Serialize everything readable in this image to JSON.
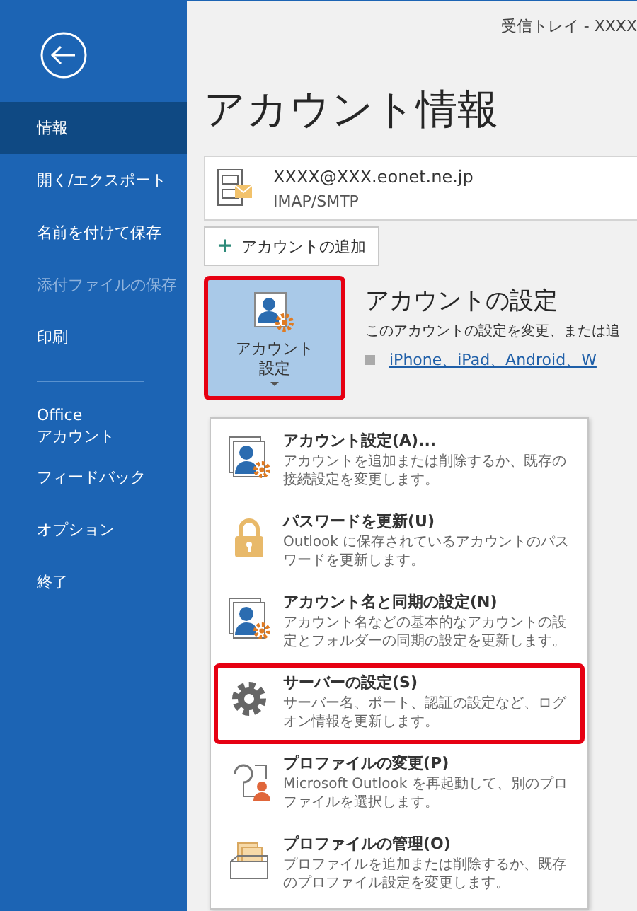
{
  "window": {
    "title": "受信トレイ - XXXX"
  },
  "sidebar": {
    "groups": [
      {
        "items": [
          {
            "label": "情報",
            "selected": true,
            "disabled": false
          },
          {
            "label": "開く/エクスポート",
            "selected": false,
            "disabled": false
          },
          {
            "label": "名前を付けて保存",
            "selected": false,
            "disabled": false
          },
          {
            "label": "添付ファイルの保存",
            "selected": false,
            "disabled": true
          },
          {
            "label": "印刷",
            "selected": false,
            "disabled": false
          }
        ]
      },
      {
        "items": [
          {
            "label": "Office\nアカウント",
            "selected": false,
            "disabled": false
          },
          {
            "label": "フィードバック",
            "selected": false,
            "disabled": false
          },
          {
            "label": "オプション",
            "selected": false,
            "disabled": false
          },
          {
            "label": "終了",
            "selected": false,
            "disabled": false
          }
        ]
      }
    ]
  },
  "heading": "アカウント情報",
  "account": {
    "email": "XXXX@XXX.eonet.ne.jp",
    "type": "IMAP/SMTP"
  },
  "add_account_button": {
    "icon": "+",
    "label": "アカウントの追加"
  },
  "account_settings": {
    "button": {
      "label_lines": [
        "アカウント",
        "設定"
      ],
      "highlighted": true
    },
    "title": "アカウントの設定",
    "description": "このアカウントの設定を変更、または追",
    "link": "iPhone、iPad、Android、W"
  },
  "menu": {
    "items": [
      {
        "kind": "account",
        "title": "アカウント設定(A)...",
        "description": "アカウントを追加または削除するか、既存の接続設定を変更します。",
        "highlighted": false
      },
      {
        "kind": "lock",
        "title": "パスワードを更新(U)",
        "description": "Outlook に保存されているアカウントのパスワードを更新します。",
        "highlighted": false
      },
      {
        "kind": "account",
        "title": "アカウント名と同期の設定(N)",
        "description": "アカウント名などの基本的なアカウントの設定とフォルダーの同期の設定を更新します。",
        "highlighted": false
      },
      {
        "kind": "gear",
        "title": "サーバーの設定(S)",
        "description": "サーバー名、ポート、認証の設定など、ログオン情報を更新します。",
        "highlighted": true
      },
      {
        "kind": "profile-change",
        "title": "プロファイルの変更(P)",
        "description": "Microsoft Outlook を再起動して、別のプロファイルを選択します。",
        "highlighted": false
      },
      {
        "kind": "profile-manage",
        "title": "プロファイルの管理(O)",
        "description": "プロファイルを追加または削除するか、既存のプロファイル設定を変更します。",
        "highlighted": false
      }
    ]
  }
}
